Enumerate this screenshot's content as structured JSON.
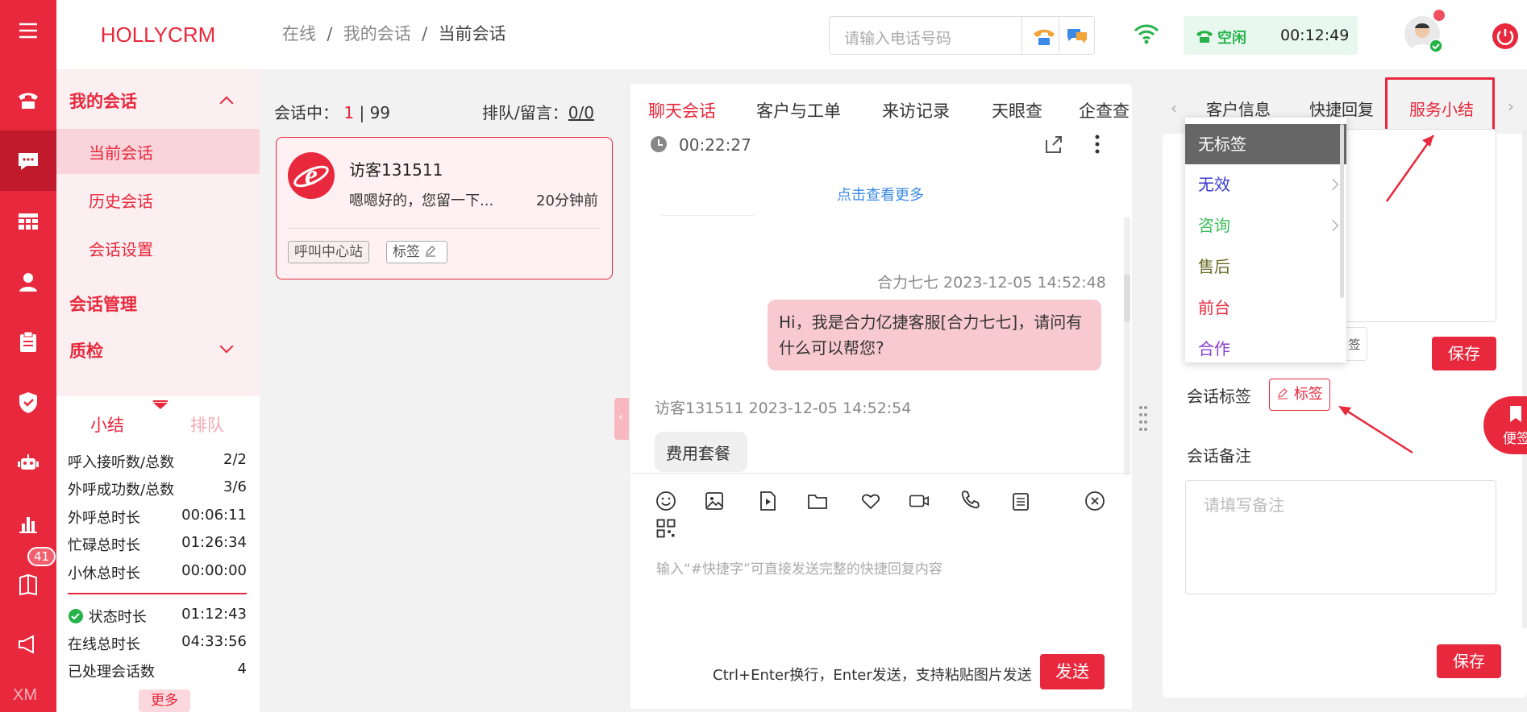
{
  "app": {
    "logo": "HOLLYCRM"
  },
  "rail": {
    "badge": "41",
    "bottom_text": "XM"
  },
  "sidebar": {
    "section_my": "我的会话",
    "items": [
      "当前会话",
      "历史会话",
      "会话设置"
    ],
    "section_manage": "会话管理",
    "section_qc": "质检",
    "tabs": {
      "summary": "小结",
      "queue": "排队"
    },
    "stats": [
      {
        "label": "呼入接听数/总数",
        "value": "2/2"
      },
      {
        "label": "外呼成功数/总数",
        "value": "3/6"
      },
      {
        "label": "外呼总时长",
        "value": "00:06:11"
      },
      {
        "label": "忙碌总时长",
        "value": "01:26:34"
      },
      {
        "label": "小休总时长",
        "value": "00:00:00"
      }
    ],
    "stats2": [
      {
        "label": "状态时长",
        "value": "01:12:43"
      },
      {
        "label": "在线总时长",
        "value": "04:33:56"
      },
      {
        "label": "已处理会话数",
        "value": "4"
      }
    ],
    "more": "更多"
  },
  "header": {
    "breadcrumb": [
      "在线",
      "我的会话",
      "当前会话"
    ],
    "search_placeholder": "请输入电话号码",
    "status_label": "空闲",
    "timer": "00:12:49"
  },
  "conversations": {
    "active_label": "会话中：",
    "active_count": "1",
    "separator": "|",
    "total": "99",
    "queue_label": "排队/留言：",
    "queue_value": "0/0",
    "card": {
      "name": "访客131511",
      "preview": "嗯嗯好的，您留一下...",
      "time": "20分钟前",
      "tag1": "呼叫中心站",
      "tag2": "标签"
    }
  },
  "tabs": [
    "聊天会话",
    "客户与工单",
    "来访记录",
    "天眼查",
    "企查查"
  ],
  "right_tabs": [
    "客户信息",
    "快捷回复",
    "服务小结"
  ],
  "chat": {
    "duration": "00:22:27",
    "load_more": "点击查看更多",
    "agent_meta": "合力七七 2023-12-05 14:52:48",
    "agent_msg": "Hi，我是合力亿捷客服[合力七七]，请问有什么可以帮您?",
    "visitor_meta": "访客131511 2023-12-05 14:52:54",
    "visitor_msg": "费用套餐",
    "input_placeholder": "输入“#快捷字”可直接发送完整的快捷回复内容",
    "hint": "Ctrl+Enter换行，Enter发送，支持粘贴图片发送",
    "send": "发送"
  },
  "summary": {
    "save": "保存",
    "tag_label": "会话标签",
    "tag_button": "标签",
    "note_label": "会话备注",
    "note_placeholder": "请填写备注",
    "save2": "保存",
    "sticky": "便签",
    "hidden_fragment": "签"
  },
  "dropdown": {
    "items": [
      {
        "label": "无标签",
        "color": "#ffffff"
      },
      {
        "label": "无效",
        "color": "#3a3acf"
      },
      {
        "label": "咨询",
        "color": "#3cbf5a"
      },
      {
        "label": "售后",
        "color": "#6b6b2a"
      },
      {
        "label": "前台",
        "color": "#e8283c"
      },
      {
        "label": "合作",
        "color": "#8a3fd1"
      }
    ]
  },
  "colors": {
    "brand": "#e8283c",
    "online": "#27b34a"
  }
}
